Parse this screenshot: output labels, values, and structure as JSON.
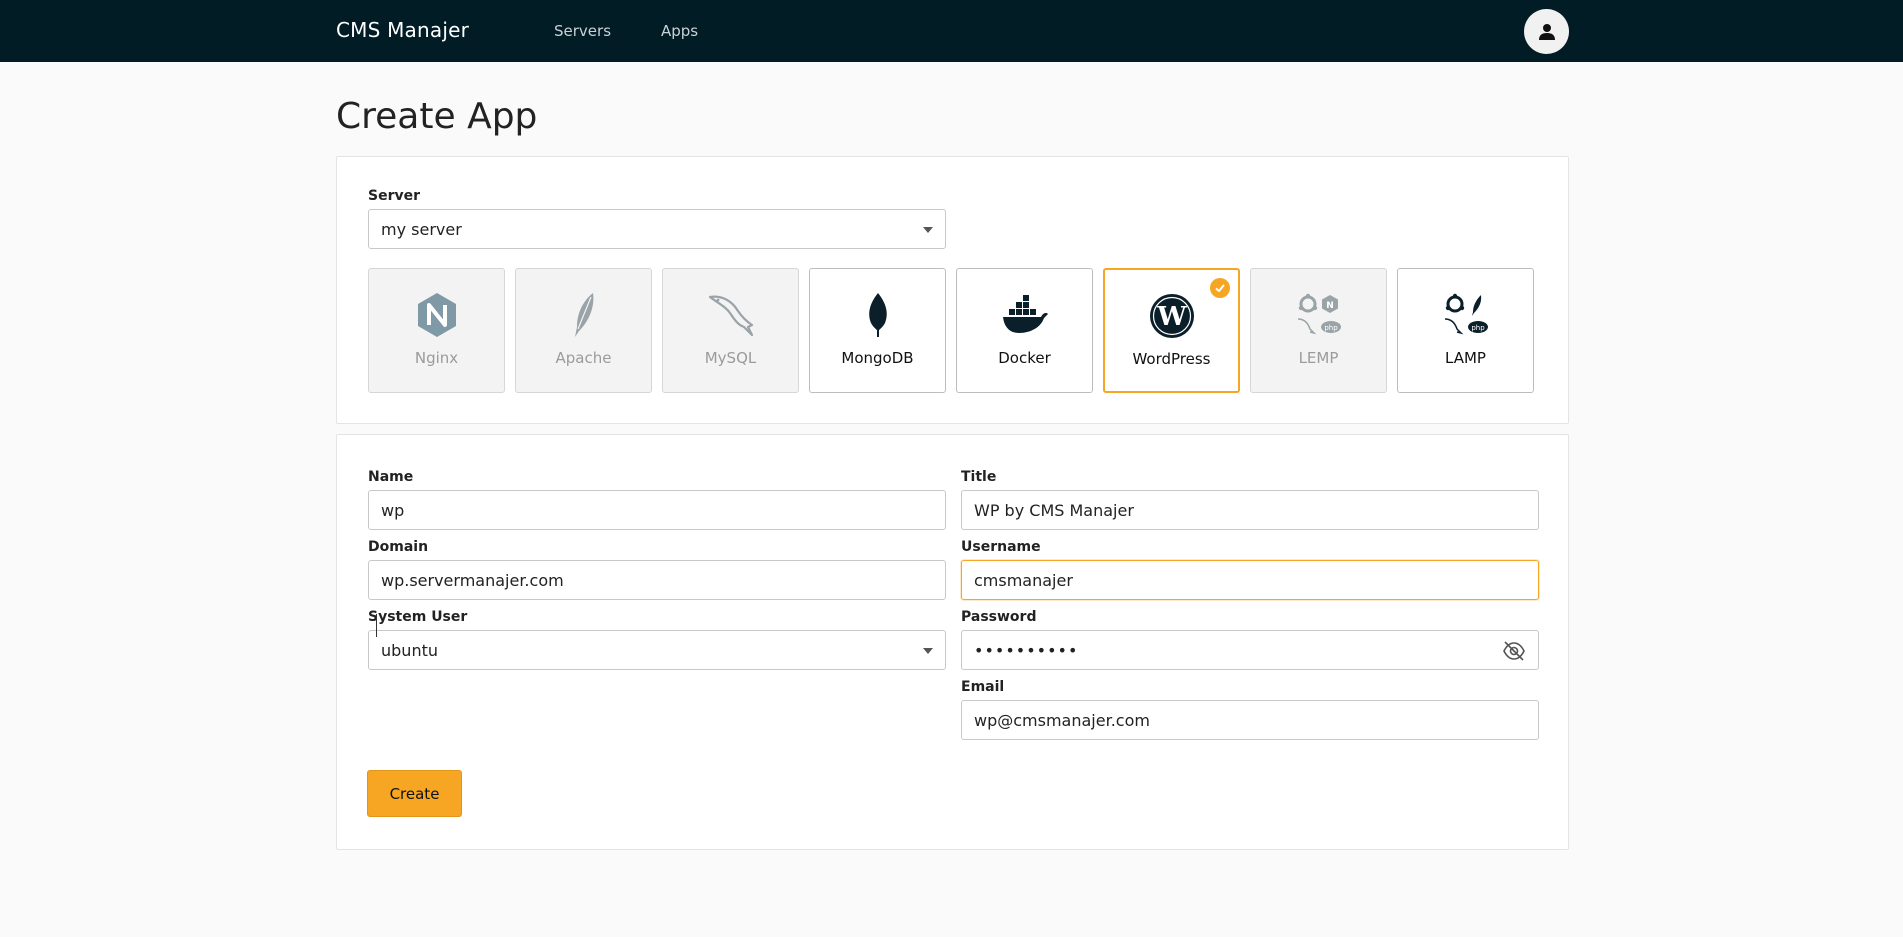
{
  "nav": {
    "brand": "CMS Manajer",
    "links": [
      "Servers",
      "Apps"
    ]
  },
  "page": {
    "title": "Create App"
  },
  "server": {
    "label": "Server",
    "value": "my server"
  },
  "app_types": [
    {
      "label": "Nginx",
      "state": "disabled"
    },
    {
      "label": "Apache",
      "state": "disabled"
    },
    {
      "label": "MySQL",
      "state": "disabled"
    },
    {
      "label": "MongoDB",
      "state": "enabled"
    },
    {
      "label": "Docker",
      "state": "enabled"
    },
    {
      "label": "WordPress",
      "state": "selected"
    },
    {
      "label": "LEMP",
      "state": "disabled"
    },
    {
      "label": "LAMP",
      "state": "enabled"
    }
  ],
  "form": {
    "name": {
      "label": "Name",
      "value": "wp"
    },
    "domain": {
      "label": "Domain",
      "value": "wp.servermanajer.com"
    },
    "system_user": {
      "label": "System User",
      "value": "ubuntu"
    },
    "title": {
      "label": "Title",
      "value": "WP by CMS Manajer"
    },
    "username": {
      "label": "Username",
      "value": "cmsmanajer"
    },
    "password": {
      "label": "Password",
      "value": "••••••••••"
    },
    "email": {
      "label": "Email",
      "value": "wp@cmsmanajer.com"
    },
    "submit_label": "Create"
  },
  "colors": {
    "navbar": "#021c26",
    "accent": "#f6a623"
  }
}
